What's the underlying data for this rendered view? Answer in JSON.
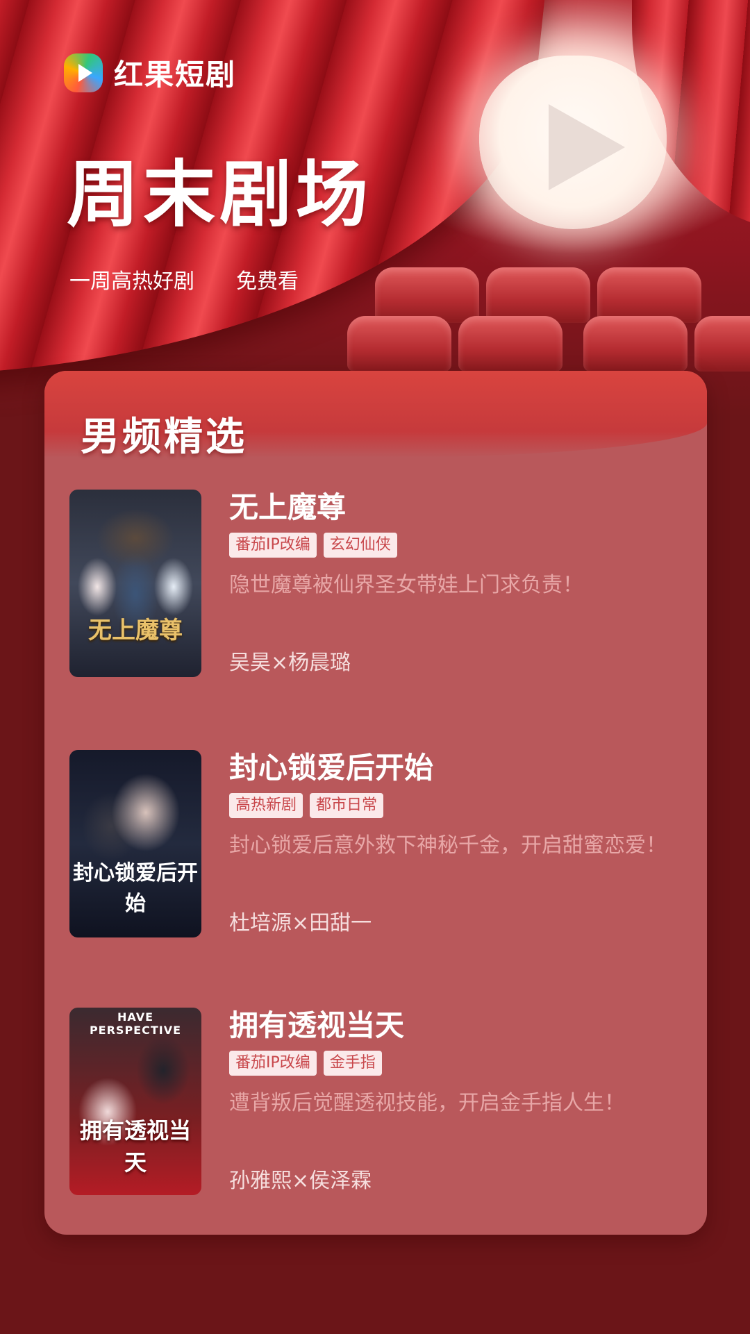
{
  "brand": {
    "name": "红果短剧"
  },
  "headline": "周末剧场",
  "sublines": [
    "一周高热好剧",
    "免费看"
  ],
  "section": {
    "title": "男频精选"
  },
  "items": [
    {
      "title": "无上魔尊",
      "tags": [
        "番茄IP改编",
        "玄幻仙侠"
      ],
      "desc": "隐世魔尊被仙界圣女带娃上门求负责！",
      "cast": "吴昊×杨晨璐",
      "poster_text": "无上魔尊"
    },
    {
      "title": "封心锁爱后开始",
      "tags": [
        "高热新剧",
        "都市日常"
      ],
      "desc": "封心锁爱后意外救下神秘千金，开启甜蜜恋爱！",
      "cast": "杜培源×田甜一",
      "poster_text": "封心锁爱后开始"
    },
    {
      "title": "拥有透视当天",
      "tags": [
        "番茄IP改编",
        "金手指"
      ],
      "desc": "遭背叛后觉醒透视技能，开启金手指人生！",
      "cast": "孙雅熙×侯泽霖",
      "poster_text": "拥有透视当天",
      "poster_top": "HAVE PERSPECTIVE"
    }
  ],
  "colors": {
    "accent": "#c8474b",
    "card": "#b9585b",
    "background": "#6b1518"
  }
}
